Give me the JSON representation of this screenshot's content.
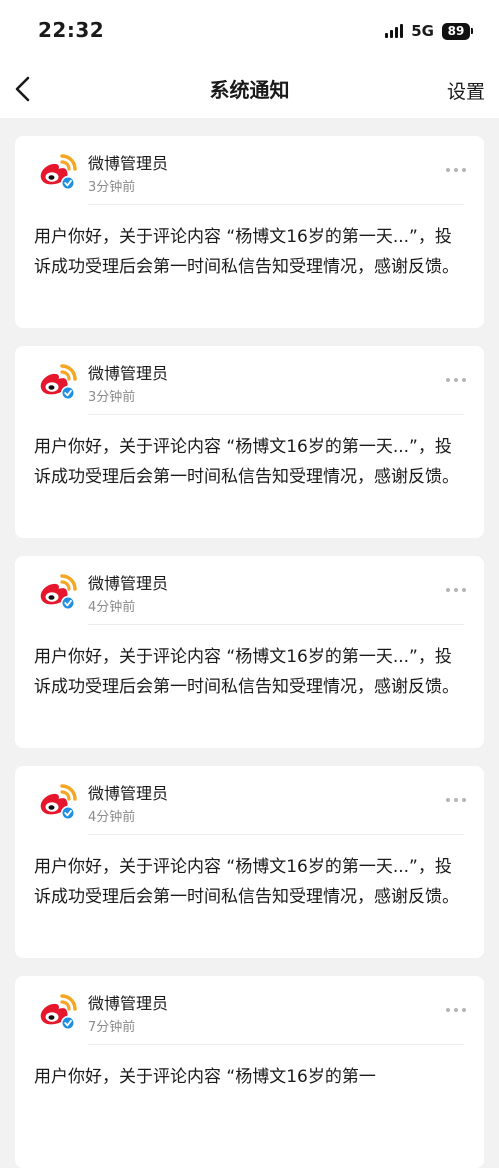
{
  "status_bar": {
    "time": "22:32",
    "network": "5G",
    "battery": "89"
  },
  "header": {
    "title": "系统通知",
    "action_label": "设置",
    "back_icon": "chevron-left-icon"
  },
  "colors": {
    "page_background": "#f2f2f2",
    "card_background": "#ffffff",
    "weibo_red": "#e6162d",
    "weibo_orange": "#f5a623",
    "verified_blue": "#1e8fe1",
    "muted_text": "#8c8c8c"
  },
  "notifications": [
    {
      "sender": "微博管理员",
      "time": "3分钟前",
      "body": "用户你好，关于评论内容 “杨博文16岁的第一天...”，投诉成功受理后会第一时间私信告知受理情况，感谢反馈。"
    },
    {
      "sender": "微博管理员",
      "time": "3分钟前",
      "body": "用户你好，关于评论内容 “杨博文16岁的第一天...”，投诉成功受理后会第一时间私信告知受理情况，感谢反馈。"
    },
    {
      "sender": "微博管理员",
      "time": "4分钟前",
      "body": "用户你好，关于评论内容 “杨博文16岁的第一天...”，投诉成功受理后会第一时间私信告知受理情况，感谢反馈。"
    },
    {
      "sender": "微博管理员",
      "time": "4分钟前",
      "body": "用户你好，关于评论内容 “杨博文16岁的第一天...”，投诉成功受理后会第一时间私信告知受理情况，感谢反馈。"
    },
    {
      "sender": "微博管理员",
      "time": "7分钟前",
      "body": "用户你好，关于评论内容 “杨博文16岁的第一"
    }
  ]
}
